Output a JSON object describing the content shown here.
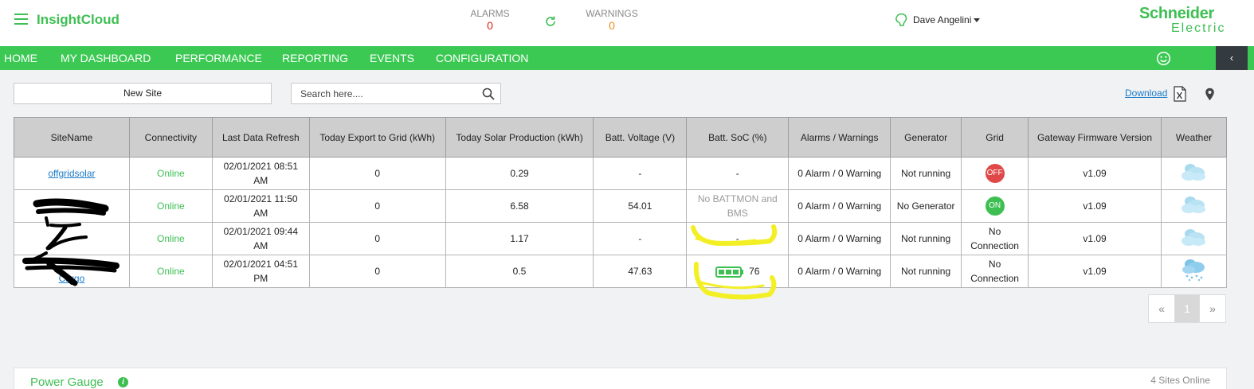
{
  "header": {
    "app_title": "InsightCloud",
    "alarms_label": "ALARMS",
    "alarms_count": "0",
    "warnings_label": "WARNINGS",
    "warnings_count": "0",
    "user_name": "Dave Angelini",
    "logo_line1": "Schneider",
    "logo_line2": "Electric"
  },
  "nav": {
    "items": [
      "HOME",
      "MY DASHBOARD",
      "PERFORMANCE",
      "REPORTING",
      "EVENTS",
      "CONFIGURATION"
    ],
    "collapse_label": "‹"
  },
  "toolbar": {
    "new_site_label": "New Site",
    "search_placeholder": "Search here....",
    "download_label": "Download"
  },
  "table": {
    "headers": [
      "SiteName",
      "Connectivity",
      "Last Data Refresh",
      "Today Export to Grid (kWh)",
      "Today Solar Production (kWh)",
      "Batt. Voltage (V)",
      "Batt. SoC (%)",
      "Alarms / Warnings",
      "Generator",
      "Grid",
      "Gateway Firmware Version",
      "Weather"
    ],
    "rows": [
      {
        "site": "offgridsolar",
        "connectivity": "Online",
        "refresh": "02/01/2021 08:51 AM",
        "export": "0",
        "solar": "0.29",
        "voltage": "-",
        "soc": "-",
        "alarms": "0 Alarm / 0 Warning",
        "generator": "Not running",
        "grid": "OFF",
        "firmware": "v1.09",
        "weather": "cloudy-icon"
      },
      {
        "site": "",
        "connectivity": "Online",
        "refresh": "02/01/2021 11:50 AM",
        "export": "0",
        "solar": "6.58",
        "voltage": "54.01",
        "soc": "No BATTMON and BMS",
        "alarms": "0 Alarm / 0 Warning",
        "generator": "No Generator",
        "grid": "ON",
        "firmware": "v1.09",
        "weather": "cloudy-icon"
      },
      {
        "site": "",
        "connectivity": "Online",
        "refresh": "02/01/2021 09:44 AM",
        "export": "0",
        "solar": "1.17",
        "voltage": "-",
        "soc": "-",
        "alarms": "0 Alarm / 0 Warning",
        "generator": "Not running",
        "grid": "No Connection",
        "firmware": "v1.09",
        "weather": "cloudy-icon"
      },
      {
        "site": "Cargo",
        "connectivity": "Online",
        "refresh": "02/01/2021 04:51 PM",
        "export": "0",
        "solar": "0.5",
        "voltage": "47.63",
        "soc": "76",
        "alarms": "0 Alarm / 0 Warning",
        "generator": "Not running",
        "grid": "No Connection",
        "firmware": "v1.09",
        "weather": "snow-cloud-icon"
      }
    ]
  },
  "pagination": {
    "prev": "«",
    "current": "1",
    "next": "»"
  },
  "power_gauge": {
    "title": "Power Gauge",
    "info": "i",
    "sites_online": "4 Sites Online"
  },
  "colors": {
    "brand_green": "#3dbf52",
    "nav_green": "#3cc953",
    "alarm_red": "#e02020",
    "warning_orange": "#e8901a",
    "link_blue": "#1a7bc8"
  }
}
